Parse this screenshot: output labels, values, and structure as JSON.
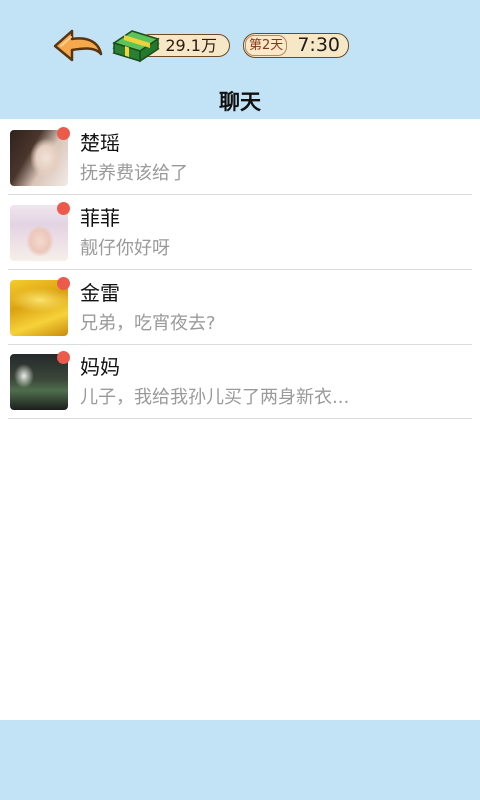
{
  "top_bar": {
    "back_icon": "back-arrow-icon",
    "money": {
      "icon": "money-stack-icon",
      "value": "29.1万"
    },
    "day": "第2天",
    "time": "7:30"
  },
  "page_title": "聊天",
  "chats": [
    {
      "name": "楚瑶",
      "message": "抚养费该给了",
      "unread": true
    },
    {
      "name": "菲菲",
      "message": "靓仔你好呀",
      "unread": true
    },
    {
      "name": "金雷",
      "message": "兄弟，吃宵夜去?",
      "unread": true
    },
    {
      "name": "妈妈",
      "message": "儿子，我给我孙儿买了两身新衣...",
      "unread": true
    }
  ],
  "colors": {
    "bar_background": "#c2e3f6",
    "unread_dot": "#ec5a4c",
    "secondary_text": "#9a9a9a"
  }
}
